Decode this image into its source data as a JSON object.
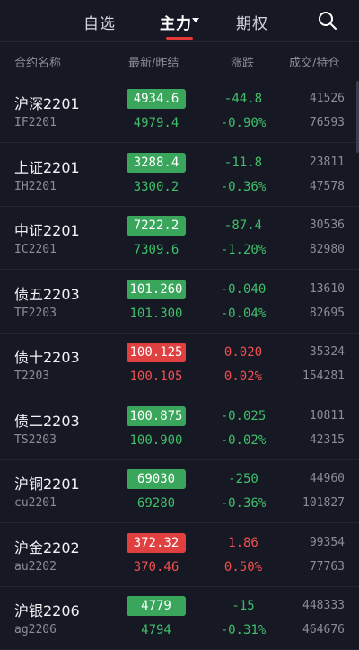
{
  "tabs": [
    {
      "label": "自选"
    },
    {
      "label": "主力"
    },
    {
      "label": "期权"
    }
  ],
  "header": {
    "name_col": "合约名称",
    "price_col": "最新/昨结",
    "change_col": "涨跌",
    "volume_col": "成交/持仓"
  },
  "colors": {
    "up": "#e0403f",
    "down": "#3aa65b",
    "background": "#161824"
  },
  "rows": [
    {
      "name": "沪深2201",
      "code": "IF2201",
      "last": "4934.6",
      "prev": "4979.4",
      "change": "-44.8",
      "pct": "-0.90%",
      "volume": "41526",
      "oi": "76593",
      "dir": "down"
    },
    {
      "name": "上证2201",
      "code": "IH2201",
      "last": "3288.4",
      "prev": "3300.2",
      "change": "-11.8",
      "pct": "-0.36%",
      "volume": "23811",
      "oi": "47578",
      "dir": "down"
    },
    {
      "name": "中证2201",
      "code": "IC2201",
      "last": "7222.2",
      "prev": "7309.6",
      "change": "-87.4",
      "pct": "-1.20%",
      "volume": "30536",
      "oi": "82980",
      "dir": "down"
    },
    {
      "name": "债五2203",
      "code": "TF2203",
      "last": "101.260",
      "prev": "101.300",
      "change": "-0.040",
      "pct": "-0.04%",
      "volume": "13610",
      "oi": "82695",
      "dir": "down"
    },
    {
      "name": "债十2203",
      "code": "T2203",
      "last": "100.125",
      "prev": "100.105",
      "change": "0.020",
      "pct": "0.02%",
      "volume": "35324",
      "oi": "154281",
      "dir": "up"
    },
    {
      "name": "债二2203",
      "code": "TS2203",
      "last": "100.875",
      "prev": "100.900",
      "change": "-0.025",
      "pct": "-0.02%",
      "volume": "10811",
      "oi": "42315",
      "dir": "down"
    },
    {
      "name": "沪铜2201",
      "code": "cu2201",
      "last": "69030",
      "prev": "69280",
      "change": "-250",
      "pct": "-0.36%",
      "volume": "44960",
      "oi": "101827",
      "dir": "down"
    },
    {
      "name": "沪金2202",
      "code": "au2202",
      "last": "372.32",
      "prev": "370.46",
      "change": "1.86",
      "pct": "0.50%",
      "volume": "99354",
      "oi": "77763",
      "dir": "up"
    },
    {
      "name": "沪银2206",
      "code": "ag2206",
      "last": "4779",
      "prev": "4794",
      "change": "-15",
      "pct": "-0.31%",
      "volume": "448333",
      "oi": "464676",
      "dir": "down"
    }
  ]
}
